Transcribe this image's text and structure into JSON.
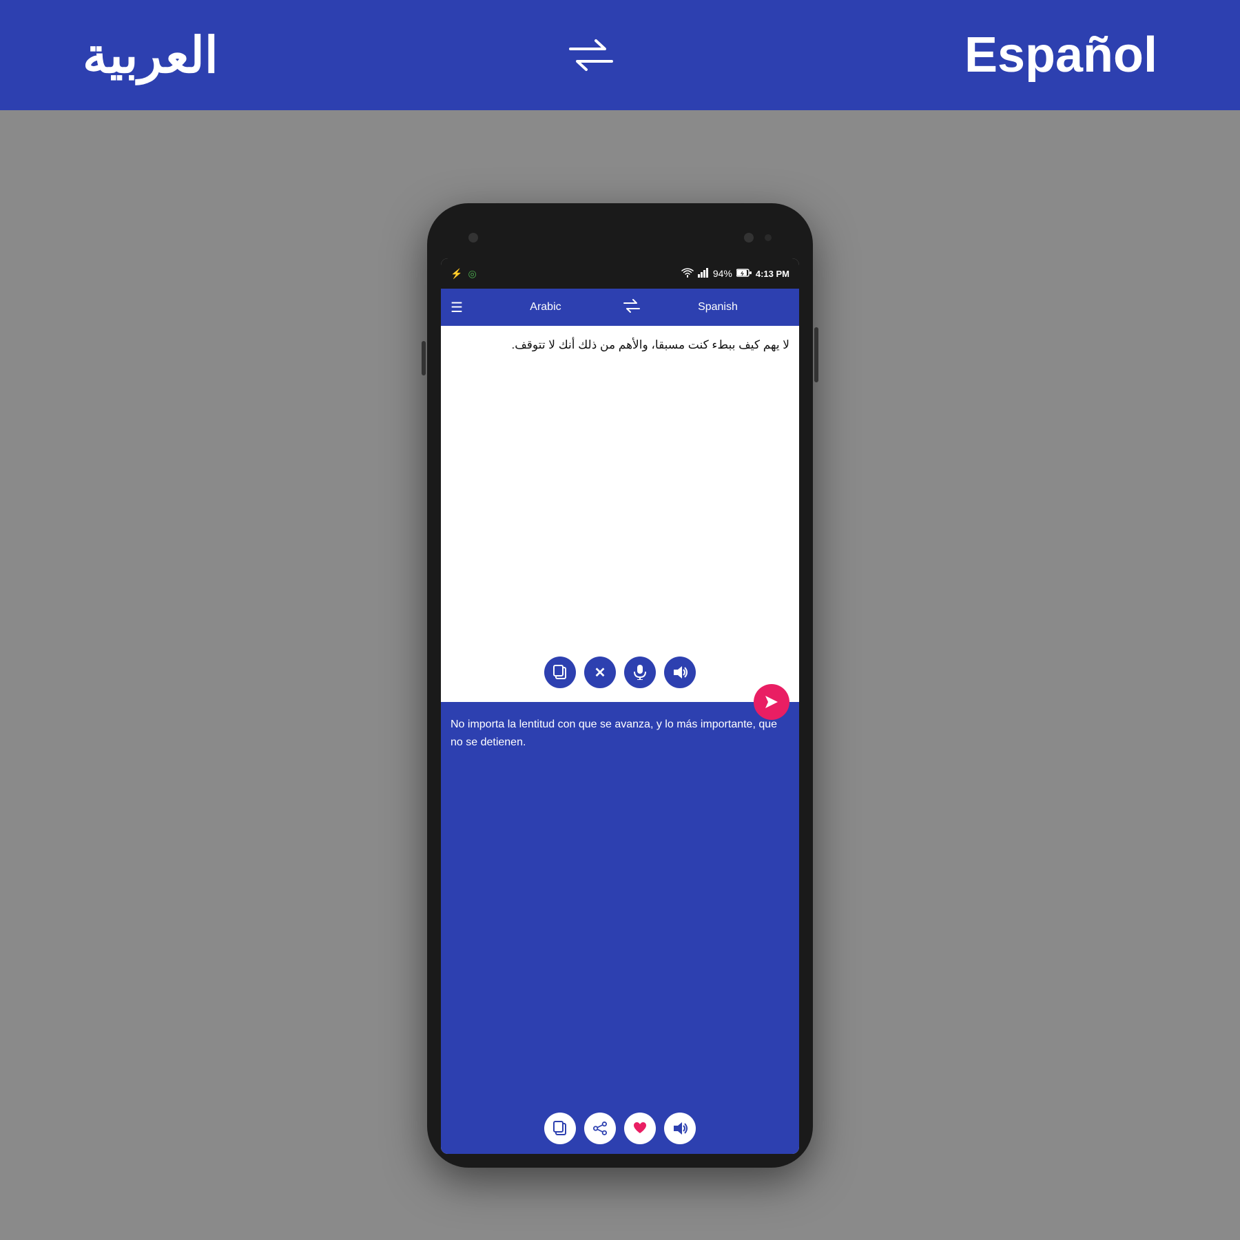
{
  "header": {
    "lang_source": "العربية",
    "lang_target": "Español",
    "swap_icon": "⇄"
  },
  "status_bar": {
    "time": "4:13 PM",
    "battery": "94%",
    "usb_icon": "⚡",
    "wifi_icon": "📶"
  },
  "nav": {
    "source_lang": "Arabic",
    "target_lang": "Spanish",
    "menu_icon": "☰",
    "swap_icon": "⇄"
  },
  "source": {
    "text": "لا يهم كيف ببطء كنت مسبقا، والأهم من ذلك أنك لا تتوقف.",
    "btn_copy": "📋",
    "btn_clear": "✕",
    "btn_mic": "🎤",
    "btn_speaker": "🔊"
  },
  "translation": {
    "text": "No importa la lentitud con que se avanza, y lo más importante, que no se detienen.",
    "btn_copy": "⧉",
    "btn_share": "⤴",
    "btn_heart": "♥",
    "btn_speaker": "🔊"
  },
  "send_icon": "➤"
}
